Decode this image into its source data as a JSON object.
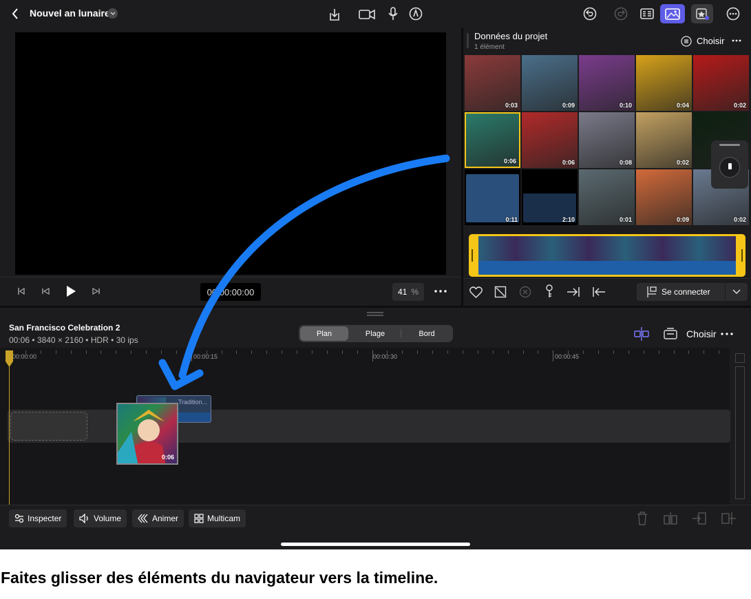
{
  "topbar": {
    "back_icon": "chevron-left-icon",
    "project_title": "Nouvel an lunaire",
    "icons": [
      "share-icon",
      "camera-icon",
      "mic-icon",
      "pencil-tip-icon",
      "undo-icon",
      "redo-icon",
      "inspector-list-icon",
      "photos-icon",
      "effects-icon",
      "more-icon"
    ],
    "accent": "#5e5ce6"
  },
  "viewer": {
    "timecode": "00:00:00:00",
    "zoom_value": "41",
    "zoom_unit": "%",
    "controls": [
      "skip-start-icon",
      "step-back-icon",
      "play-icon",
      "step-forward-icon",
      "more-icon"
    ]
  },
  "browser": {
    "title": "Données du projet",
    "subtitle": "1 élément",
    "choose_label": "Choisir",
    "thumbnails": [
      {
        "duration": "0:03",
        "color": "#8b3a3a"
      },
      {
        "duration": "0:09",
        "color": "#4a6f8a"
      },
      {
        "duration": "0:10",
        "color": "#7a3c8c"
      },
      {
        "duration": "0:04",
        "color": "#d6a11a"
      },
      {
        "duration": "0:02",
        "color": "#b51a1a"
      },
      {
        "duration": "0:06",
        "color": "#2a7a6a",
        "selected": true
      },
      {
        "duration": "0:06",
        "color": "#b22a2a"
      },
      {
        "duration": "0:08",
        "color": "#7a7a8a"
      },
      {
        "duration": "0:02",
        "color": "#c2a060"
      },
      {
        "duration": "",
        "color": "#0d2010"
      },
      {
        "duration": "0:11",
        "color": "#2a4f7a",
        "audio": true
      },
      {
        "duration": "2:10",
        "color": "#1a2f4a",
        "audio": true
      },
      {
        "duration": "0:01",
        "color": "#5a6a70"
      },
      {
        "duration": "0:09",
        "color": "#d26a3a"
      },
      {
        "duration": "0:02",
        "color": "#6a7a90"
      }
    ],
    "bottom_connect_label": "Se connecter",
    "bottom_icons": [
      "heart-icon",
      "reject-icon",
      "clear-icon",
      "keyword-icon",
      "insert-icon",
      "append-icon"
    ]
  },
  "timeline": {
    "project_name": "San Francisco Celebration 2",
    "project_meta": "00:06 • 3840 × 2160 • HDR • 30 ips",
    "segments": [
      "Plan",
      "Plage",
      "Bord"
    ],
    "active_segment": 0,
    "choose_label": "Choisir",
    "ruler": [
      "00:00:00",
      "00:00:15",
      "00:00:30",
      "00:00:45"
    ],
    "dragged_clip_label": "Tradition...",
    "dragged_clip_duration": "0:06"
  },
  "bottom_toolbar": {
    "inspect_label": "Inspecter",
    "volume_label": "Volume",
    "animate_label": "Animer",
    "multicam_label": "Multicam",
    "right_icons": [
      "trash-icon",
      "split-icon",
      "detach-icon",
      "replace-icon"
    ]
  },
  "caption": "Faites glisser des éléments du navigateur vers la timeline."
}
